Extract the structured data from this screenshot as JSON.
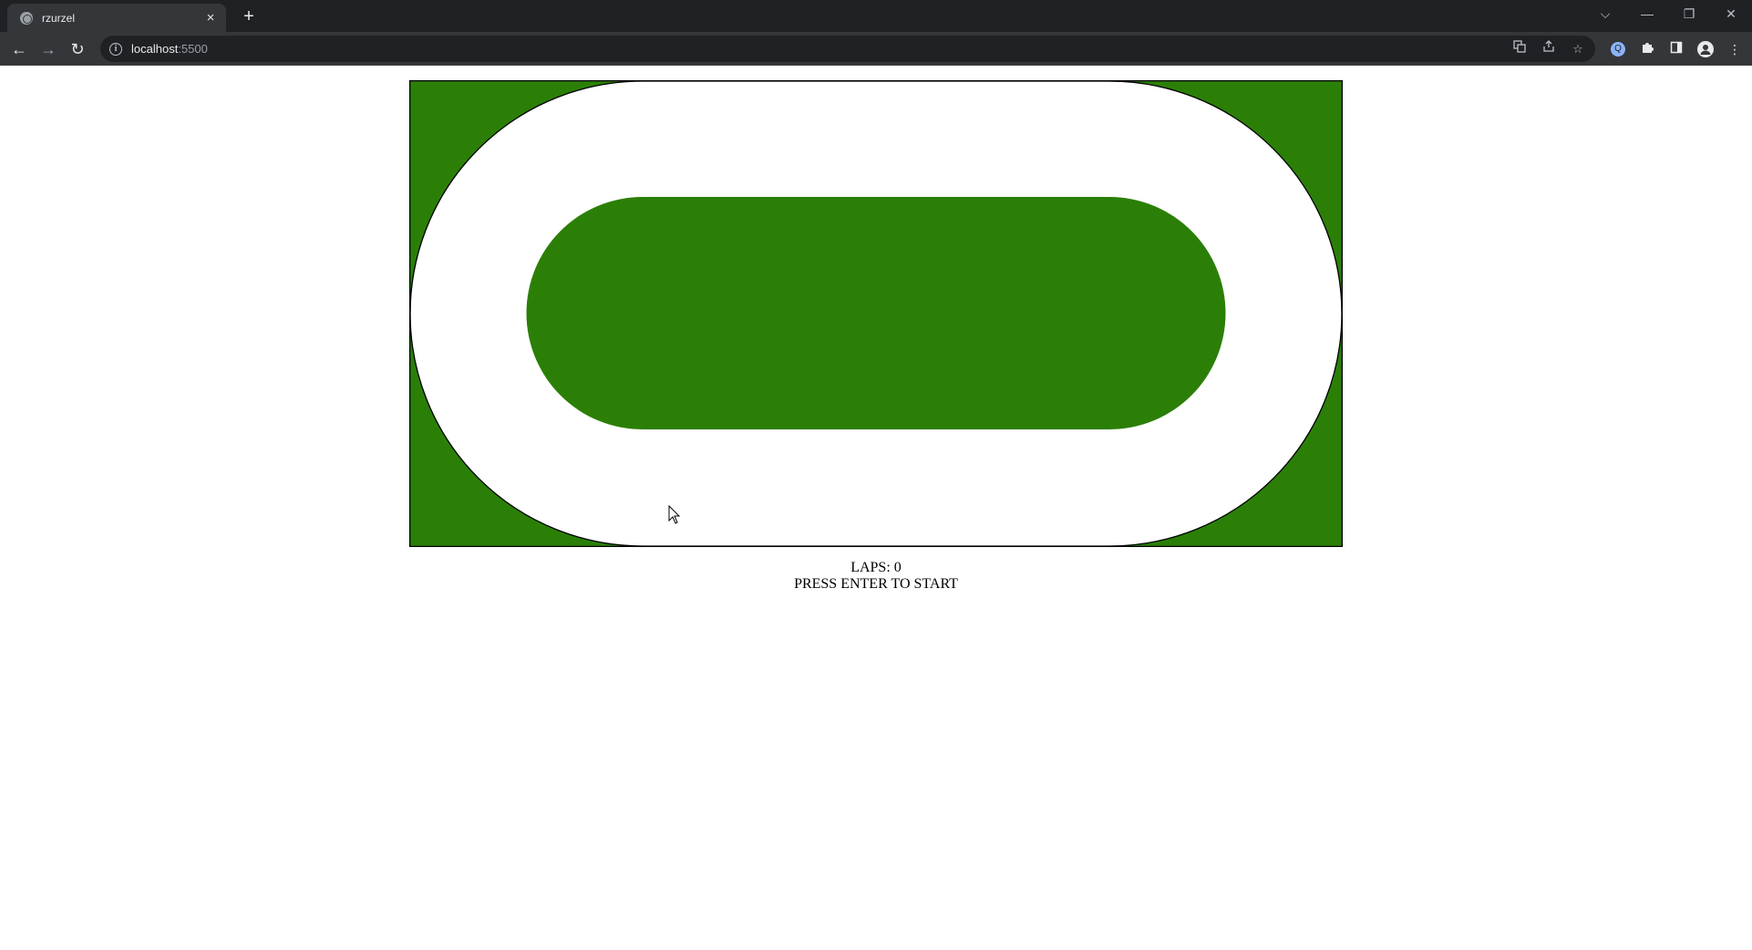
{
  "browser": {
    "tab": {
      "title": "rzurzel",
      "close_glyph": "×"
    },
    "new_tab_glyph": "+",
    "window_controls": {
      "dropdown": "⌵",
      "minimize": "—",
      "restore": "❐",
      "close": "✕"
    },
    "nav": {
      "back": "←",
      "forward": "→",
      "reload": "↻"
    },
    "address": {
      "host": "localhost",
      "port": ":5500"
    },
    "omnibox_icons": [
      "translate-icon",
      "share-icon",
      "bookmark-star-icon"
    ],
    "toolbar_icons": [
      "extension-profile-icon",
      "extensions-puzzle-icon",
      "side-panel-icon",
      "profile-avatar-icon",
      "menu-kebab-icon"
    ]
  },
  "game": {
    "colors": {
      "grass": "#2b7f07",
      "track": "#ffffff",
      "border": "#000000"
    },
    "hud": {
      "laps_label": "LAPS: 0",
      "prompt": "PRESS ENTER TO START"
    }
  }
}
